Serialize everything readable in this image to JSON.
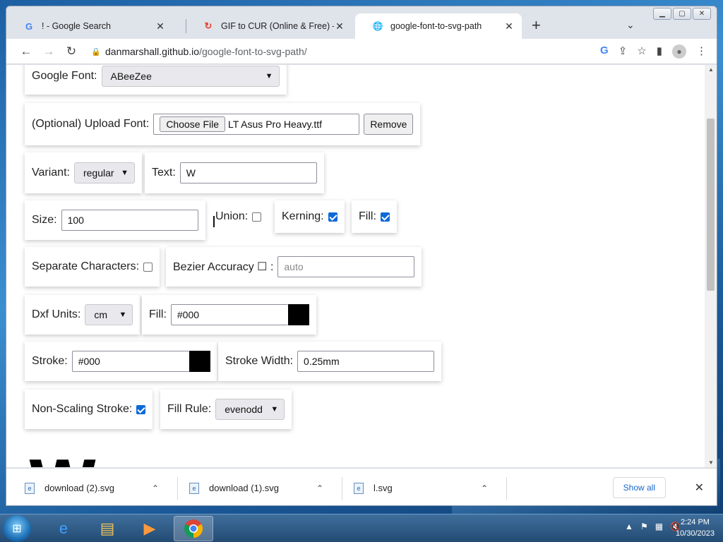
{
  "browser": {
    "tabs": [
      {
        "title": "! - Google Search",
        "favicon": "google-g-icon",
        "glyph": "G"
      },
      {
        "title": "GIF to CUR (Online & Free) — C",
        "favicon": "convertio-icon",
        "glyph": "↻"
      },
      {
        "title": "google-font-to-svg-path",
        "favicon": "globe-icon",
        "glyph": "🌐"
      }
    ],
    "new_tab_glyph": "+",
    "tab_list_glyph": "⌄",
    "url_host": "danmarshall.github.io",
    "url_path": "/google-font-to-svg-path/"
  },
  "form": {
    "google_font_label": "Google Font:",
    "google_font_value": "ABeeZee",
    "upload_label": "(Optional) Upload Font:",
    "choose_file_label": "Choose File",
    "chosen_file_name": "LT Asus Pro Heavy.ttf",
    "remove_label": "Remove",
    "variant_label": "Variant:",
    "variant_value": "regular",
    "text_label": "Text:",
    "text_value": "W",
    "size_label": "Size:",
    "size_value": "100",
    "union_label": "Union:",
    "union_checked": false,
    "kerning_label": "Kerning:",
    "kerning_checked": true,
    "fill_check_label": "Fill:",
    "fill_checked": true,
    "separate_label": "Separate Characters:",
    "separate_checked": false,
    "bezier_label": "Bezier Accuracy ☐ :",
    "bezier_placeholder": "auto",
    "dxf_label": "Dxf Units:",
    "dxf_value": "cm",
    "fill_label": "Fill:",
    "fill_value": "#000",
    "stroke_label": "Stroke:",
    "stroke_value": "#000",
    "stroke_width_label": "Stroke Width:",
    "stroke_width_value": "0.25mm",
    "non_scaling_label": "Non-Scaling Stroke:",
    "non_scaling_checked": true,
    "fill_rule_label": "Fill Rule:",
    "fill_rule_value": "evenodd",
    "preview_text": "W"
  },
  "downloads": {
    "items": [
      {
        "name": "download (2).svg"
      },
      {
        "name": "download (1).svg"
      },
      {
        "name": "l.svg"
      }
    ],
    "show_all_label": "Show all"
  },
  "taskbar": {
    "time": "2:24 PM",
    "date": "10/30/2023"
  },
  "colors": {
    "accent": "#0b6ad8",
    "fill_swatch": "#000000",
    "stroke_swatch": "#000000"
  }
}
